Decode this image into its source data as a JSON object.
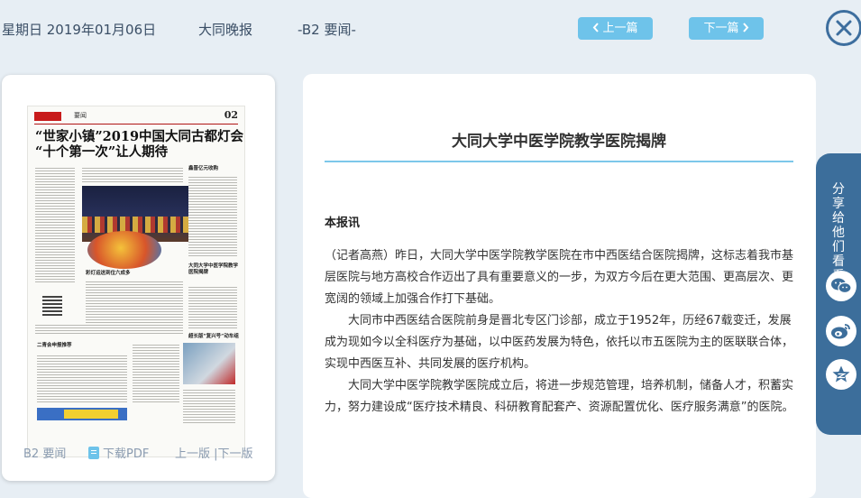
{
  "header": {
    "date": "星期日 2019年01月06日",
    "paper_name": "大同晚报",
    "section": "-B2 要闻-",
    "prev_label": "上一篇",
    "next_label": "下一篇"
  },
  "thumbnail": {
    "page_number": "02",
    "masthead_section": "要闻",
    "headline_line1": "“世家小镇”2019中国大同古都灯会",
    "headline_line2": "“十个第一次”让人期待",
    "side_headline_1": "鑫晋亿元收购",
    "side_headline_2": "大同大学中医学院教学医院揭牌",
    "side_headline_3": "超长版“复兴号”动车组",
    "mid_headline_1": "彩灯运送到位六成多",
    "mid_headline_2": "二青会申报推荐",
    "footer_section": "B2 要闻",
    "footer_pdf": "下载PDF",
    "footer_prev_page": "上一版",
    "footer_separator": "|",
    "footer_next_page": "下一版"
  },
  "article": {
    "title": "大同大学中医学院教学医院揭牌",
    "source": "本报讯",
    "paragraphs": [
      "（记者高燕）昨日，大同大学中医学院教学医院在市中西医结合医院揭牌，这标志着我市基层医院与地方高校合作迈出了具有重要意义的一步，为双方今后在更大范围、更高层次、更宽阔的领域上加强合作打下基础。",
      "大同市中西医结合医院前身是晋北专区门诊部，成立于1952年，历经67载变迁，发展成为现如今以全科医疗为基础，以中医药发展为特色，依托以市五医院为主的医联联合体，实现中西医互补、共同发展的医疗机构。",
      "大同大学中医学院教学医院成立后，将进一步规范管理，培养机制，储备人才，积蓄实力，努力建设成“医疗技术精良、科研教育配套产、资源配置优化、医疗服务满意”的医院。"
    ]
  },
  "share": {
    "label": "分享给他们看看",
    "icons": [
      "wechat-icon",
      "weibo-icon",
      "qzone-icon"
    ]
  },
  "colors": {
    "accent_button": "#6ec3ea",
    "share_tab": "#3c6e9b",
    "title_rule": "#7cc7ea",
    "background": "#e7eef4"
  }
}
